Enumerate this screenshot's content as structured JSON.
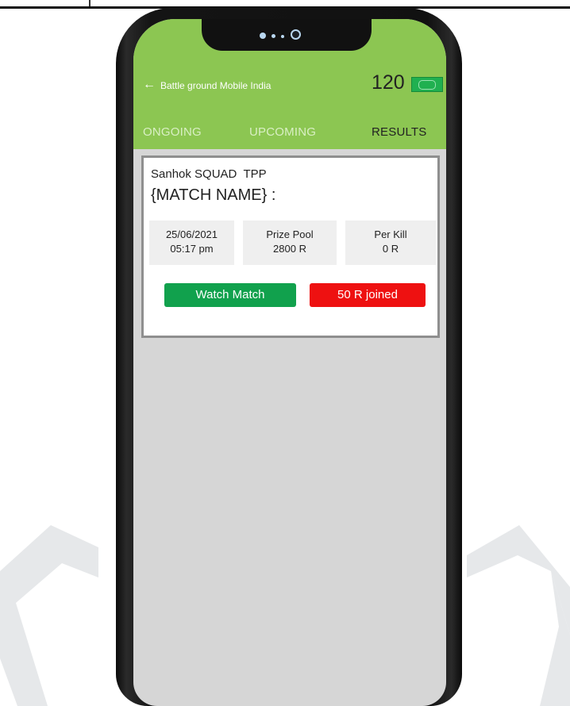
{
  "header": {
    "title": "Battle ground Mobile India",
    "coins": "120",
    "back_icon": "arrow-left-icon",
    "wallet_icon": "wallet-icon"
  },
  "tabs": [
    {
      "label": "ONGOING",
      "active": false
    },
    {
      "label": "UPCOMING",
      "active": false
    },
    {
      "label": "RESULTS",
      "active": true
    }
  ],
  "match": {
    "map_mode": "Sanhok SQUAD  TPP",
    "name": "{MATCH NAME} :",
    "date": "25/06/2021",
    "time": "05:17 pm",
    "prize_pool_label": "Prize Pool",
    "prize_pool_value": "2800 R",
    "per_kill_label": "Per Kill",
    "per_kill_value": "0 R",
    "watch_label": "Watch Match",
    "joined_label": "50 R joined"
  },
  "colors": {
    "header_green": "#8cc652",
    "watch_button": "#11a14d",
    "joined_button": "#ee1111",
    "screen_bg": "#d6d6d6"
  }
}
